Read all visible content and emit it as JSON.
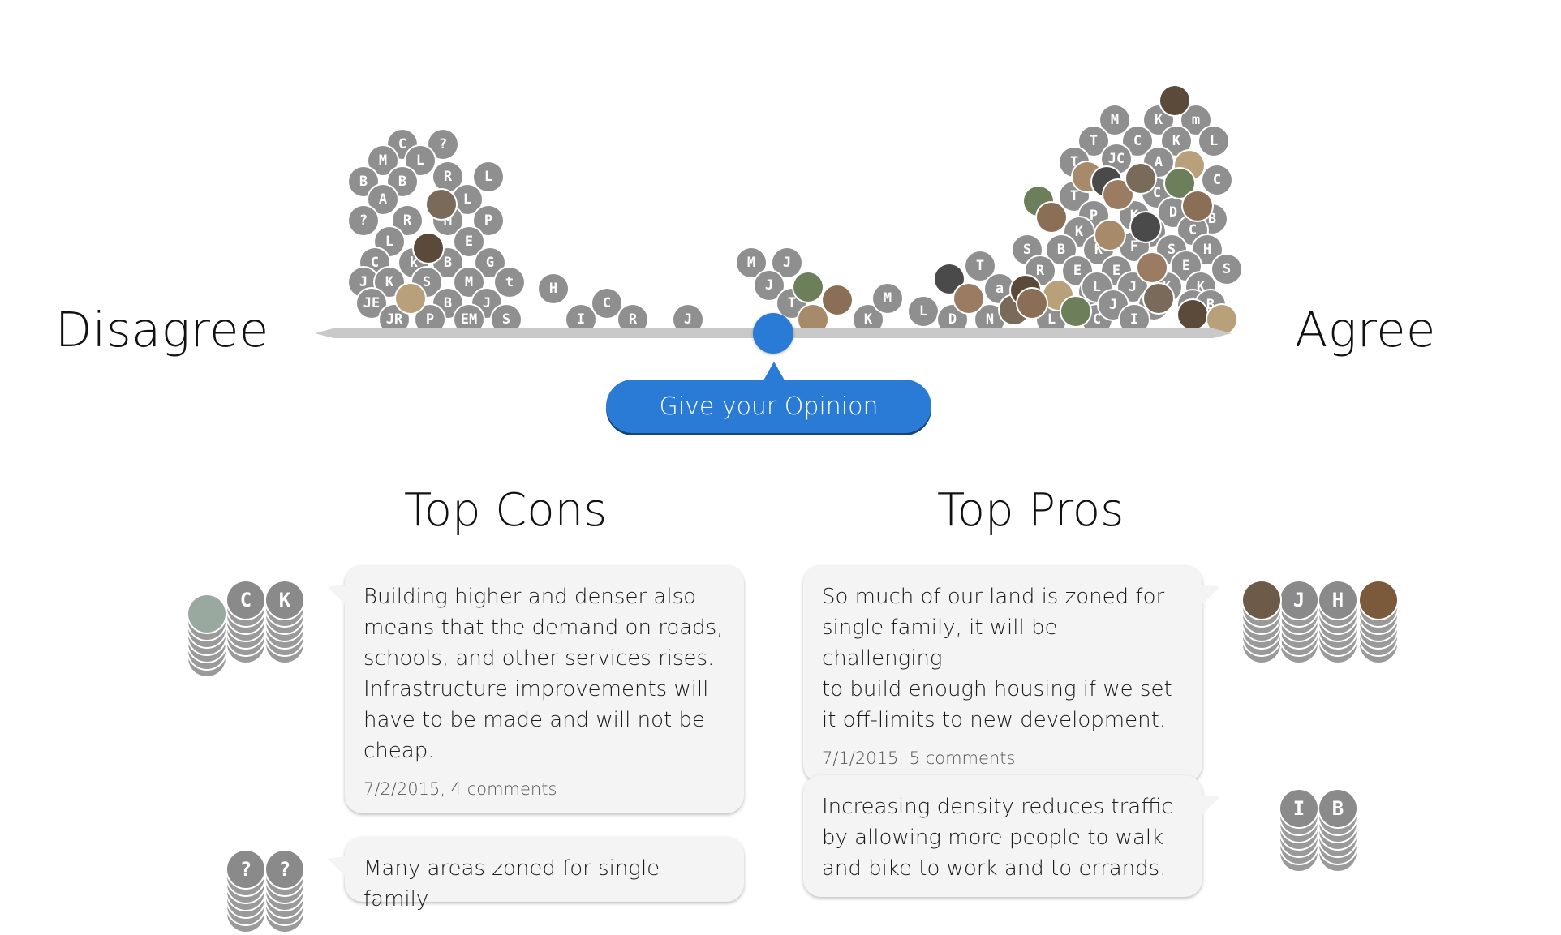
{
  "scale": {
    "left_label": "Disagree",
    "right_label": "Agree",
    "button_label": "Give your Opinion"
  },
  "colors": {
    "accent": "#2a7bd6",
    "avatar_gray": "#8f8f8f",
    "track": "#c9c9c9",
    "card_bg": "#f4f4f4"
  },
  "avatars": [
    "C",
    "?",
    "M",
    "L",
    "B",
    "B",
    "R",
    "L",
    "A",
    "L",
    "?",
    "R",
    "M",
    "P",
    "L",
    "E",
    "C",
    "k",
    "B",
    "G",
    "J",
    "K",
    "S",
    "M",
    "t",
    "H",
    "JE",
    "B",
    "J",
    "JR",
    "P",
    "EM",
    "S",
    "I",
    "C",
    "R",
    "J",
    "M",
    "J",
    "J",
    "T",
    "K",
    "M",
    "L",
    "D",
    "N",
    "T",
    "a",
    "M",
    "K",
    "m",
    "T",
    "C",
    "K",
    "L",
    "T",
    "JC",
    "A",
    "C",
    "T",
    "C",
    "P",
    "K",
    "D",
    "B",
    "K",
    "K",
    "C",
    "S",
    "B",
    "K",
    "F",
    "S",
    "H",
    "R",
    "E",
    "E",
    "E",
    "S",
    "S",
    "L",
    "J",
    "K",
    "K",
    "L",
    "C",
    "J",
    "A",
    "A",
    "B",
    "I"
  ],
  "sections": {
    "cons_title": "Top Cons",
    "pros_title": "Top Pros"
  },
  "cons": [
    {
      "text": "Building higher and denser also\nmeans that the demand on roads,\nschools, and other services rises.\nInfrastructure improvements will\nhave to be made and will not be\ncheap.",
      "meta": "7/2/2015, 4 comments",
      "voters": [
        "C",
        "K"
      ]
    },
    {
      "text": "Many areas zoned for single family",
      "meta": "",
      "voters": [
        "?",
        "?"
      ]
    }
  ],
  "pros": [
    {
      "text": "So much of our land is zoned for\nsingle family, it will be challenging\nto build enough housing if we set\nit off-limits to new development.",
      "meta": "7/1/2015, 5 comments",
      "voters": [
        "J",
        "H"
      ]
    },
    {
      "text": "Increasing density reduces traffic\nby allowing more people to walk\nand bike to work and to errands.",
      "meta": "",
      "voters": [
        "I",
        "B"
      ]
    }
  ]
}
